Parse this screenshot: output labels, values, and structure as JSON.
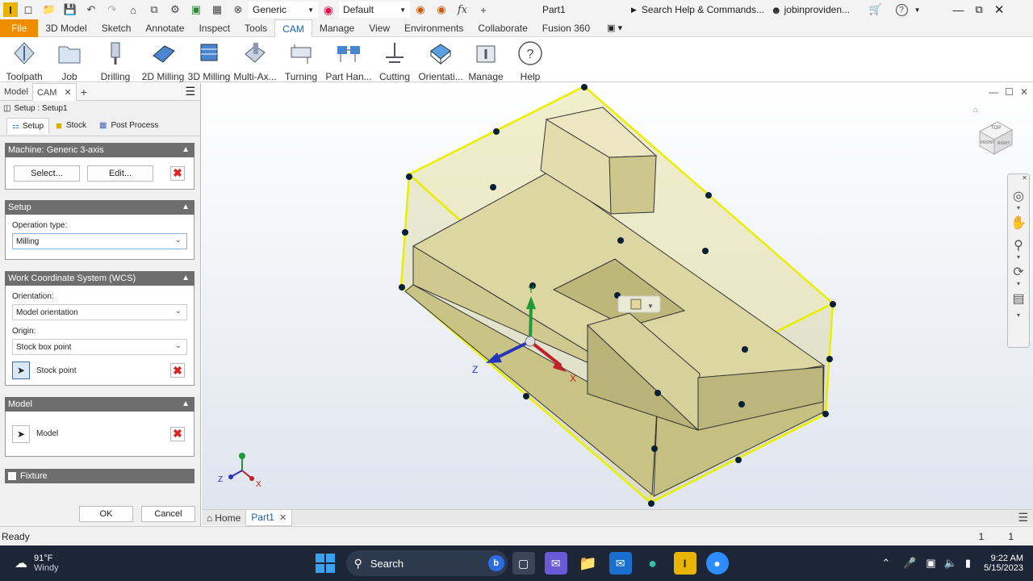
{
  "titlebar": {
    "material": "Generic",
    "appearance": "Default",
    "doc_title": "Part1",
    "search_placeholder": "Search Help & Commands...",
    "user": "jobinproviden..."
  },
  "ribbon_tabs": [
    "File",
    "3D Model",
    "Sketch",
    "Annotate",
    "Inspect",
    "Tools",
    "CAM",
    "Manage",
    "View",
    "Environments",
    "Collaborate",
    "Fusion 360"
  ],
  "ribbon_buttons": [
    "Toolpath",
    "Job",
    "Drilling",
    "2D Milling",
    "3D Milling",
    "Multi-Ax...",
    "Turning",
    "Part Han...",
    "Cutting",
    "Orientati...",
    "Manage",
    "Help"
  ],
  "panel": {
    "tab_model": "Model",
    "tab_cam": "CAM",
    "setup_title": "Setup : Setup1",
    "subtabs": [
      "Setup",
      "Stock",
      "Post Process"
    ],
    "machine_header": "Machine: Generic 3-axis",
    "select_btn": "Select...",
    "edit_btn": "Edit...",
    "setup_header": "Setup",
    "operation_type_label": "Operation type:",
    "operation_type_value": "Milling",
    "wcs_header": "Work Coordinate System (WCS)",
    "orientation_label": "Orientation:",
    "orientation_value": "Model orientation",
    "origin_label": "Origin:",
    "origin_value": "Stock box point",
    "stock_point": "Stock point",
    "model_header": "Model",
    "model_label": "Model",
    "fixture_label": "Fixture",
    "ok": "OK",
    "cancel": "Cancel"
  },
  "doc_tabs": {
    "home": "Home",
    "part": "Part1"
  },
  "status": {
    "text": "Ready",
    "c1": "1",
    "c2": "1"
  },
  "taskbar": {
    "temp": "91°F",
    "weather": "Windy",
    "search": "Search",
    "time": "9:22 AM",
    "date": "5/15/2023"
  },
  "axes": {
    "x": "X",
    "y": "Y",
    "z": "Z"
  },
  "viewcube": {
    "top": "TOP",
    "front": "FRONT",
    "right": "RIGHT"
  }
}
